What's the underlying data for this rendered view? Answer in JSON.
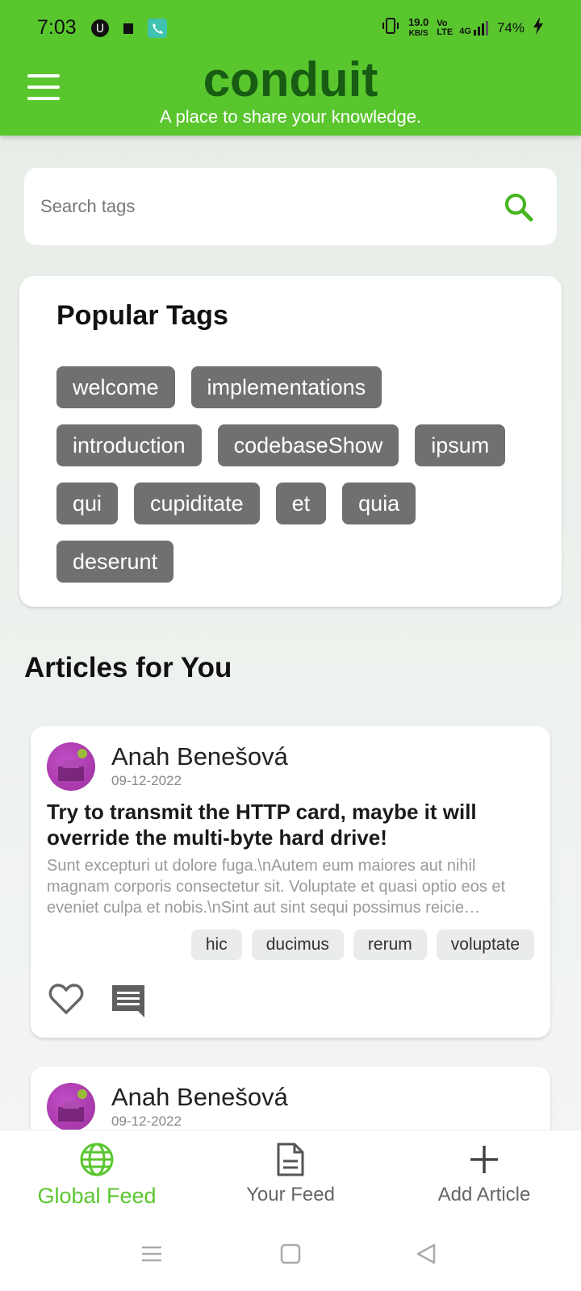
{
  "status_bar": {
    "time": "7:03",
    "net_speed_value": "19.0",
    "net_speed_unit": "KB/S",
    "volte": "Vo LTE",
    "signal": "4G",
    "battery": "74%"
  },
  "header": {
    "title": "conduit",
    "subtitle": "A place to share your knowledge."
  },
  "search": {
    "placeholder": "Search tags",
    "value": ""
  },
  "popular_tags": {
    "title": "Popular Tags",
    "tags": [
      "welcome",
      "implementations",
      "introduction",
      "codebaseShow",
      "ipsum",
      "qui",
      "cupiditate",
      "et",
      "quia",
      "deserunt"
    ]
  },
  "articles_section": {
    "title": "Articles for You"
  },
  "articles": [
    {
      "author": "Anah Benešová",
      "date": "09-12-2022",
      "title": "Try to transmit the HTTP card, maybe it will override the multi-byte hard drive!",
      "body": "Sunt excepturi ut dolore fuga.\\nAutem eum maiores aut nihil magnam corporis consectetur sit. Voluptate et quasi optio eos et eveniet culpa et nobis.\\nSint aut sint sequi possimus reicie…",
      "tags": [
        "hic",
        "ducimus",
        "rerum",
        "voluptate"
      ]
    },
    {
      "author": "Anah Benešová",
      "date": "09-12-2022"
    }
  ],
  "bottom_nav": {
    "items": [
      {
        "label": "Global Feed",
        "icon": "globe-icon"
      },
      {
        "label": "Your Feed",
        "icon": "document-icon"
      },
      {
        "label": "Add Article",
        "icon": "plus-icon"
      }
    ]
  },
  "colors": {
    "brand_green": "#5ac62e",
    "title_dark_green": "#175c12",
    "tag_gray": "#707070"
  }
}
